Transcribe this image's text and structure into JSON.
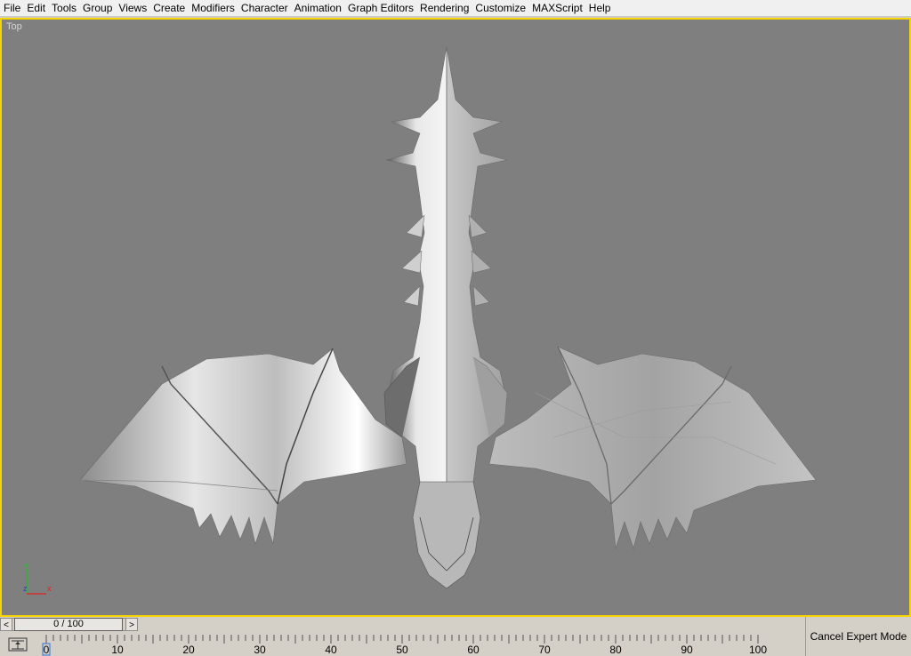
{
  "menu": {
    "items": [
      "File",
      "Edit",
      "Tools",
      "Group",
      "Views",
      "Create",
      "Modifiers",
      "Character",
      "Animation",
      "Graph Editors",
      "Rendering",
      "Customize",
      "MAXScript",
      "Help"
    ]
  },
  "viewport": {
    "label": "Top",
    "active_border_color": "#f5d400",
    "background_color": "#7f7f7f",
    "axis": {
      "y": "y",
      "z": "z",
      "x": "x"
    }
  },
  "time_slider": {
    "value": "0 / 100",
    "prev_arrow": "<",
    "next_arrow": ">"
  },
  "trackbar": {
    "ticks": [
      "0",
      "10",
      "20",
      "30",
      "40",
      "50",
      "60",
      "70",
      "80",
      "90",
      "100"
    ],
    "current_frame": 0
  },
  "expert_mode": {
    "cancel_label": "Cancel Expert Mode"
  },
  "icons": {
    "key_mode": "key-filter-icon",
    "axis": "axis-tripod-icon"
  }
}
